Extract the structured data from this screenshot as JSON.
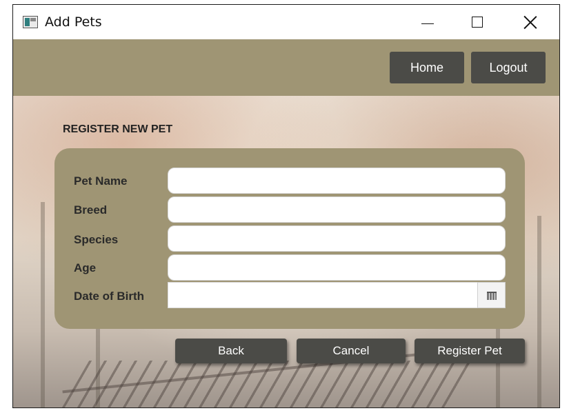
{
  "window": {
    "title": "Add Pets",
    "minimize_glyph": "minimize-icon",
    "maximize_glyph": "maximize-icon",
    "close_glyph": "close-icon"
  },
  "header": {
    "home_label": "Home",
    "logout_label": "Logout",
    "band_color": "#9f9574",
    "button_color": "#4b4b47"
  },
  "form": {
    "title": "REGISTER NEW PET",
    "fields": [
      {
        "label": "Pet Name",
        "value": "",
        "placeholder": ""
      },
      {
        "label": "Breed",
        "value": "",
        "placeholder": ""
      },
      {
        "label": "Species",
        "value": "",
        "placeholder": ""
      },
      {
        "label": "Age",
        "value": "",
        "placeholder": ""
      },
      {
        "label": "Date of Birth",
        "value": "",
        "placeholder": "",
        "icon": "calendar-icon"
      }
    ]
  },
  "actions": {
    "back_label": "Back",
    "cancel_label": "Cancel",
    "register_label": "Register Pet"
  }
}
